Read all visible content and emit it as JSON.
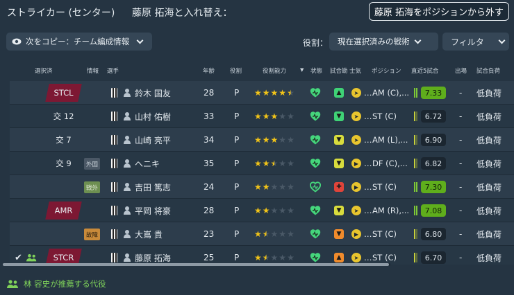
{
  "header": {
    "title": "ストライカー (センター)",
    "replace_label": "藤原 拓海と入れ替え：",
    "remove_button": "藤原 拓海をポジションから外す"
  },
  "toolbar": {
    "copy_label": "次をコピー：チーム編成情報",
    "role_label": "役割：",
    "role_select": "現在選択済みの戦術",
    "filter_label": "フィルタ"
  },
  "columns": {
    "selected": "選択済",
    "info": "情報",
    "player": "選手",
    "age": "年齢",
    "role": "役割",
    "role_ability": "役割能力",
    "condition": "状態",
    "match_fitness": "試合勘",
    "morale": "士気",
    "position": "ポジション",
    "last5": "直近5試合",
    "appearances": "出場",
    "match_load": "試合負荷"
  },
  "rows": [
    {
      "slot": "STCL",
      "slot_style": "tag",
      "info": "",
      "name": "鈴木 国友",
      "age": "28",
      "role": "P",
      "stars": 4.5,
      "position": "AM (C),...",
      "rating": "7.33",
      "rating_style": "green",
      "apps": "-",
      "load": "低負荷",
      "fit": "up-green",
      "morale": "fwd-yellow",
      "heart": "green",
      "checked": false
    },
    {
      "slot": "交 12",
      "slot_style": "plain",
      "info": "",
      "name": "山村 佑樹",
      "age": "33",
      "role": "P",
      "stars": 3,
      "position": "ST (C)",
      "rating": "6.72",
      "rating_style": "dark",
      "apps": "-",
      "load": "低負荷",
      "fit": "down-green",
      "morale": "fwd-yellow",
      "heart": "green",
      "checked": false
    },
    {
      "slot": "交 7",
      "slot_style": "plain",
      "info": "",
      "name": "山崎 亮平",
      "age": "34",
      "role": "P",
      "stars": 3,
      "position": "AM (L),...",
      "rating": "6.90",
      "rating_style": "dark",
      "apps": "-",
      "load": "低負荷",
      "fit": "down-yellow",
      "morale": "fwd-yellow",
      "heart": "green",
      "checked": false
    },
    {
      "slot": "交 9",
      "slot_style": "plain",
      "info": "外国",
      "info_style": "grey",
      "name": "ヘニキ",
      "age": "35",
      "role": "P",
      "stars": 2.5,
      "position": "DF (C),...",
      "rating": "6.82",
      "rating_style": "dark",
      "apps": "-",
      "load": "低負荷",
      "fit": "down-yellow",
      "morale": "right-yellow",
      "heart": "green",
      "checked": false
    },
    {
      "slot": "",
      "slot_style": "none",
      "info": "戦外",
      "info_style": "green",
      "name": "吉田 篤志",
      "age": "24",
      "role": "P",
      "stars": 2,
      "position": "ST (C)",
      "rating": "7.30",
      "rating_style": "green",
      "apps": "-",
      "load": "低負荷",
      "fit": "red",
      "morale": "right-yellow",
      "heart": "outline",
      "checked": false
    },
    {
      "slot": "AMR",
      "slot_style": "tag",
      "info": "",
      "name": "平岡 将豪",
      "age": "28",
      "role": "P",
      "stars": 2,
      "position": "AM (R),...",
      "rating": "7.08",
      "rating_style": "green",
      "apps": "-",
      "load": "低負荷",
      "fit": "down-yellow",
      "morale": "fwd-yellow",
      "heart": "green",
      "checked": false
    },
    {
      "slot": "",
      "slot_style": "none",
      "info": "故障",
      "info_style": "orange",
      "name": "大嶌 貴",
      "age": "23",
      "role": "P",
      "stars": 1.5,
      "position": "ST (C)",
      "rating": "6.80",
      "rating_style": "dark",
      "apps": "-",
      "load": "低負荷",
      "fit": "down-orange",
      "morale": "right-yellow",
      "heart": "green",
      "checked": false
    },
    {
      "slot": "STCR",
      "slot_style": "tag",
      "info": "",
      "name": "藤原 拓海",
      "age": "25",
      "role": "P",
      "stars": 1.5,
      "position": "ST (C)",
      "rating": "6.70",
      "rating_style": "dark",
      "apps": "-",
      "load": "低負荷",
      "fit": "up-orange",
      "morale": "fwd-yellow",
      "heart": "green",
      "checked": true
    }
  ],
  "footer": {
    "suggestion": "林 容史が推薦する代役"
  },
  "colors": {
    "background": "#253442",
    "slot_tag": "#7d1833",
    "rating_green": "#5fae1c",
    "star": "#f2c418",
    "heart_green": "#45d67c"
  }
}
